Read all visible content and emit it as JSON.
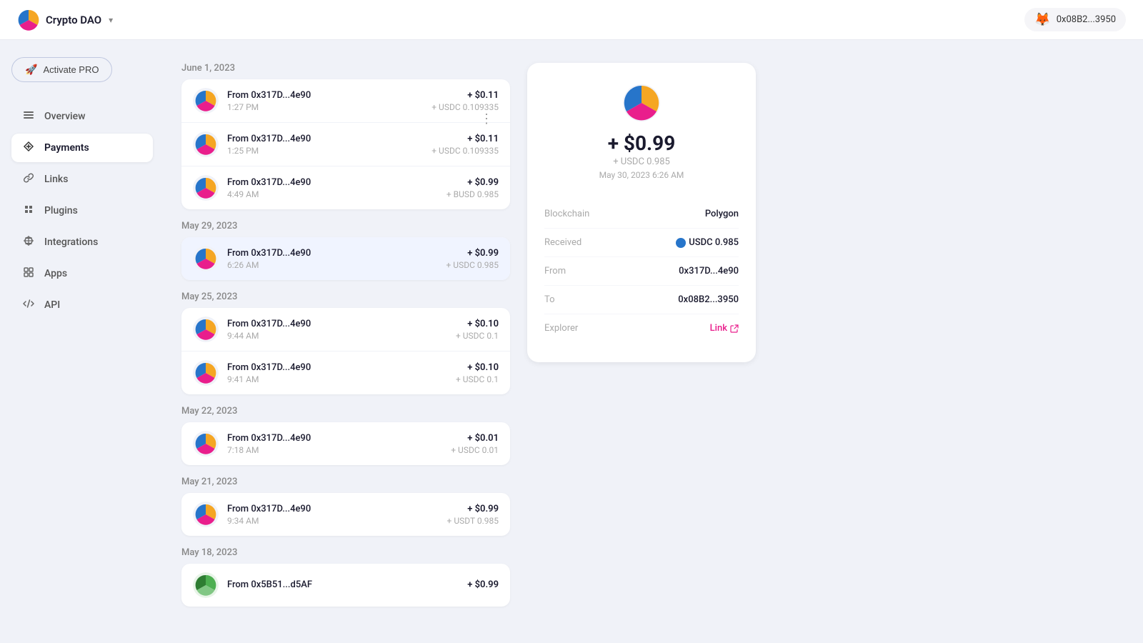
{
  "topbar": {
    "app_name": "Crypto DAO",
    "dropdown_arrow": "▾",
    "wallet_label": "0x08B2...3950",
    "fox_emoji": "🦊"
  },
  "sidebar": {
    "activate_pro_label": "Activate PRO",
    "nav_items": [
      {
        "id": "overview",
        "label": "Overview",
        "icon": "▬",
        "active": false
      },
      {
        "id": "payments",
        "label": "Payments",
        "icon": "↕",
        "active": true
      },
      {
        "id": "links",
        "label": "Links",
        "icon": "◆",
        "active": false
      },
      {
        "id": "plugins",
        "label": "Plugins",
        "icon": "❖",
        "active": false
      },
      {
        "id": "integrations",
        "label": "Integrations",
        "icon": "⊞",
        "active": false
      },
      {
        "id": "apps",
        "label": "Apps",
        "icon": "◈",
        "active": false
      },
      {
        "id": "api",
        "label": "API",
        "icon": "↻",
        "active": false
      }
    ]
  },
  "transactions": {
    "more_menu": "⋮",
    "sections": [
      {
        "date": "June 1, 2023",
        "items": [
          {
            "from": "From 0x317D...4e90",
            "time": "1:27 PM",
            "usd": "+ $0.11",
            "token": "+ USDC 0.109335",
            "selected": false
          },
          {
            "from": "From 0x317D...4e90",
            "time": "1:25 PM",
            "usd": "+ $0.11",
            "token": "+ USDC 0.109335",
            "selected": false
          },
          {
            "from": "From 0x317D...4e90",
            "time": "4:49 AM",
            "usd": "+ $0.99",
            "token": "+ BUSD 0.985",
            "selected": false
          }
        ]
      },
      {
        "date": "May 29, 2023",
        "items": [
          {
            "from": "From 0x317D...4e90",
            "time": "6:26 AM",
            "usd": "+ $0.99",
            "token": "+ USDC 0.985",
            "selected": true
          }
        ]
      },
      {
        "date": "May 25, 2023",
        "items": [
          {
            "from": "From 0x317D...4e90",
            "time": "9:44 AM",
            "usd": "+ $0.10",
            "token": "+ USDC 0.1",
            "selected": false
          },
          {
            "from": "From 0x317D...4e90",
            "time": "9:41 AM",
            "usd": "+ $0.10",
            "token": "+ USDC 0.1",
            "selected": false
          }
        ]
      },
      {
        "date": "May 22, 2023",
        "items": [
          {
            "from": "From 0x317D...4e90",
            "time": "7:18 AM",
            "usd": "+ $0.01",
            "token": "+ USDC 0.01",
            "selected": false
          }
        ]
      },
      {
        "date": "May 21, 2023",
        "items": [
          {
            "from": "From 0x317D...4e90",
            "time": "9:34 AM",
            "usd": "+ $0.99",
            "token": "+ USDT 0.985",
            "selected": false
          }
        ]
      },
      {
        "date": "May 18, 2023",
        "items": [
          {
            "from": "From 0x5B51...d5AF",
            "time": "",
            "usd": "+ $0.99",
            "token": "",
            "selected": false
          }
        ]
      }
    ]
  },
  "detail": {
    "amount_usd": "+ $0.99",
    "amount_token": "+ USDC 0.985",
    "date": "May 30, 2023 6:26 AM",
    "blockchain_label": "Blockchain",
    "blockchain_val": "Polygon",
    "received_label": "Received",
    "received_val": "USDC 0.985",
    "from_label": "From",
    "from_val": "0x317D...4e90",
    "to_label": "To",
    "to_val": "0x08B2...3950",
    "explorer_label": "Explorer",
    "explorer_val": "Link"
  }
}
